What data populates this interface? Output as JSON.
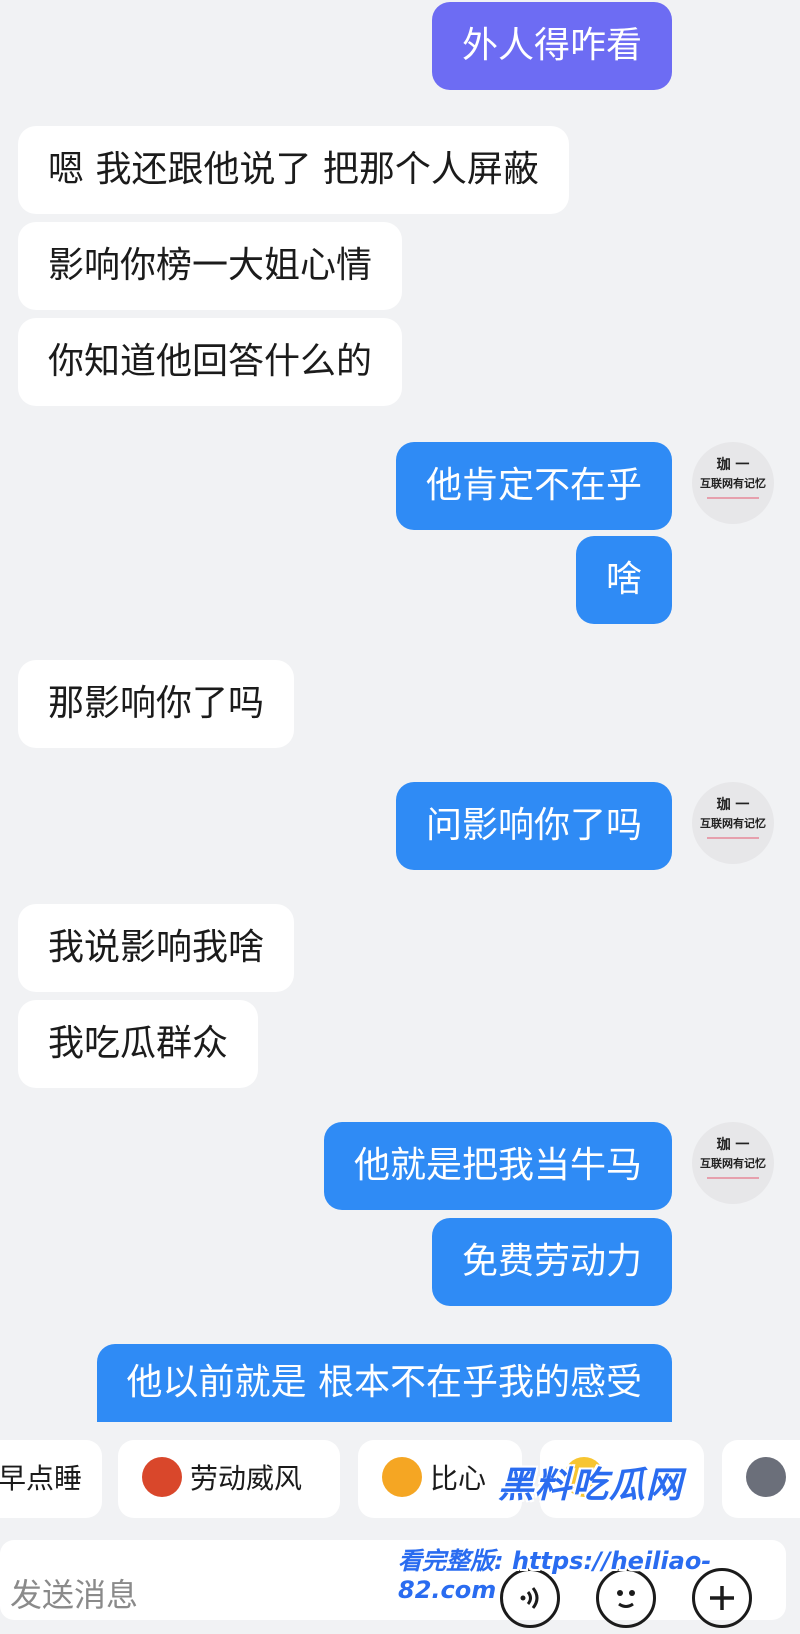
{
  "messages": [
    {
      "text": "外人得咋看",
      "side": "out"
    },
    {
      "text": "嗯 我还跟他说了 把那个人屏蔽",
      "side": "in"
    },
    {
      "text": "影响你榜一大姐心情",
      "side": "in"
    },
    {
      "text": "你知道他回答什么的",
      "side": "in"
    },
    {
      "text": "他肯定不在乎",
      "side": "out"
    },
    {
      "text": "啥",
      "side": "out"
    },
    {
      "text": "那影响你了吗",
      "side": "in"
    },
    {
      "text": "问影响你了吗",
      "side": "out"
    },
    {
      "text": "我说影响我啥",
      "side": "in"
    },
    {
      "text": "我吃瓜群众",
      "side": "in"
    },
    {
      "text": "他就是把我当牛马",
      "side": "out"
    },
    {
      "text": "免费劳动力",
      "side": "out"
    },
    {
      "text": "他以前就是 根本不在乎我的感受",
      "side": "out"
    }
  ],
  "avatar": {
    "name": "珈 一",
    "subtitle": "互联网有记忆"
  },
  "quick_replies": [
    {
      "label": "早点睡",
      "visible_label": "早点睡"
    },
    {
      "label": "劳动威风",
      "icon": "crab-emoji-icon"
    },
    {
      "label": "比心",
      "icon": "heart-hands-emoji-icon"
    },
    {
      "label": "",
      "icon": "face-emoji-icon"
    },
    {
      "label": "",
      "icon": "cat-emoji-icon"
    }
  ],
  "composer": {
    "placeholder": "发送消息"
  },
  "watermark": {
    "title": "黑料吃瓜网",
    "url_line": "看完整版: https://heiliao-82.com"
  },
  "colors": {
    "outgoing": "#2f8bf5",
    "outgoing_alt": "#6d6cf3",
    "incoming": "#ffffff",
    "background": "#f1f2f4"
  }
}
